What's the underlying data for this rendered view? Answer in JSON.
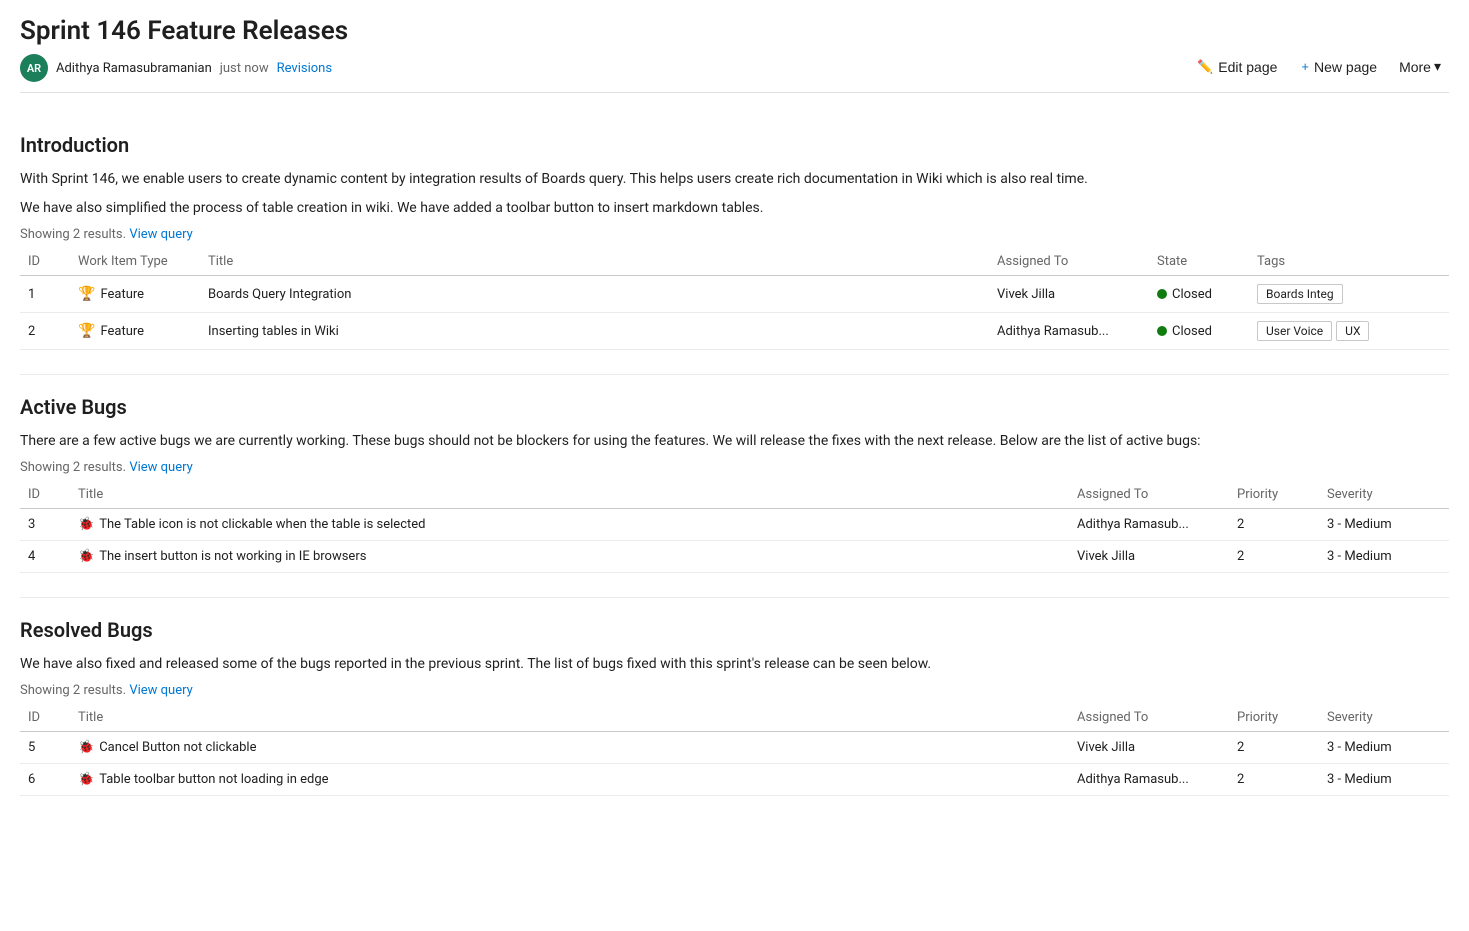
{
  "page": {
    "title": "Sprint 146 Feature Releases"
  },
  "author": {
    "initials": "AR",
    "name": "Adithya Ramasubramanian",
    "timestamp": "just now",
    "revisions_label": "Revisions"
  },
  "toolbar": {
    "edit_label": "Edit page",
    "new_page_label": "New page",
    "more_label": "More"
  },
  "sections": {
    "introduction": {
      "title": "Introduction",
      "paragraphs": [
        "With Sprint 146, we enable users to create dynamic content by integration results of Boards query. This helps users create rich documentation in Wiki which is also real time.",
        "We have also simplified the process of table creation in wiki. We have added a toolbar button to insert markdown tables."
      ],
      "results_label": "Showing 2 results.",
      "view_query_label": "View query",
      "columns": [
        "ID",
        "Work Item Type",
        "Title",
        "Assigned To",
        "State",
        "Tags"
      ],
      "rows": [
        {
          "id": "1",
          "type": "Feature",
          "title": "Boards Query Integration",
          "assigned_to": "Vivek Jilla",
          "state": "Closed",
          "tags": [
            "Boards Integ"
          ]
        },
        {
          "id": "2",
          "type": "Feature",
          "title": "Inserting tables in Wiki",
          "assigned_to": "Adithya Ramasub...",
          "state": "Closed",
          "tags": [
            "User Voice",
            "UX"
          ]
        }
      ]
    },
    "active_bugs": {
      "title": "Active Bugs",
      "description": "There are a few active bugs we are currently working. These bugs should not be blockers for using the features. We will release the fixes with the next release. Below are the list of active bugs:",
      "results_label": "Showing 2 results.",
      "view_query_label": "View query",
      "columns": [
        "ID",
        "Title",
        "Assigned To",
        "Priority",
        "Severity"
      ],
      "rows": [
        {
          "id": "3",
          "title": "The Table icon is not clickable when the table is selected",
          "assigned_to": "Adithya Ramasub...",
          "priority": "2",
          "severity": "3 - Medium"
        },
        {
          "id": "4",
          "title": "The insert button is not working in IE browsers",
          "assigned_to": "Vivek Jilla",
          "priority": "2",
          "severity": "3 - Medium"
        }
      ]
    },
    "resolved_bugs": {
      "title": "Resolved Bugs",
      "description": "We have also fixed and released some of the bugs reported in the previous sprint. The list of bugs fixed with this sprint's release can be seen below.",
      "results_label": "Showing 2 results.",
      "view_query_label": "View query",
      "columns": [
        "ID",
        "Title",
        "Assigned To",
        "Priority",
        "Severity"
      ],
      "rows": [
        {
          "id": "5",
          "title": "Cancel Button not clickable",
          "assigned_to": "Vivek Jilla",
          "priority": "2",
          "severity": "3 - Medium"
        },
        {
          "id": "6",
          "title": "Table toolbar button not loading in edge",
          "assigned_to": "Adithya Ramasub...",
          "priority": "2",
          "severity": "3 - Medium"
        }
      ]
    }
  }
}
